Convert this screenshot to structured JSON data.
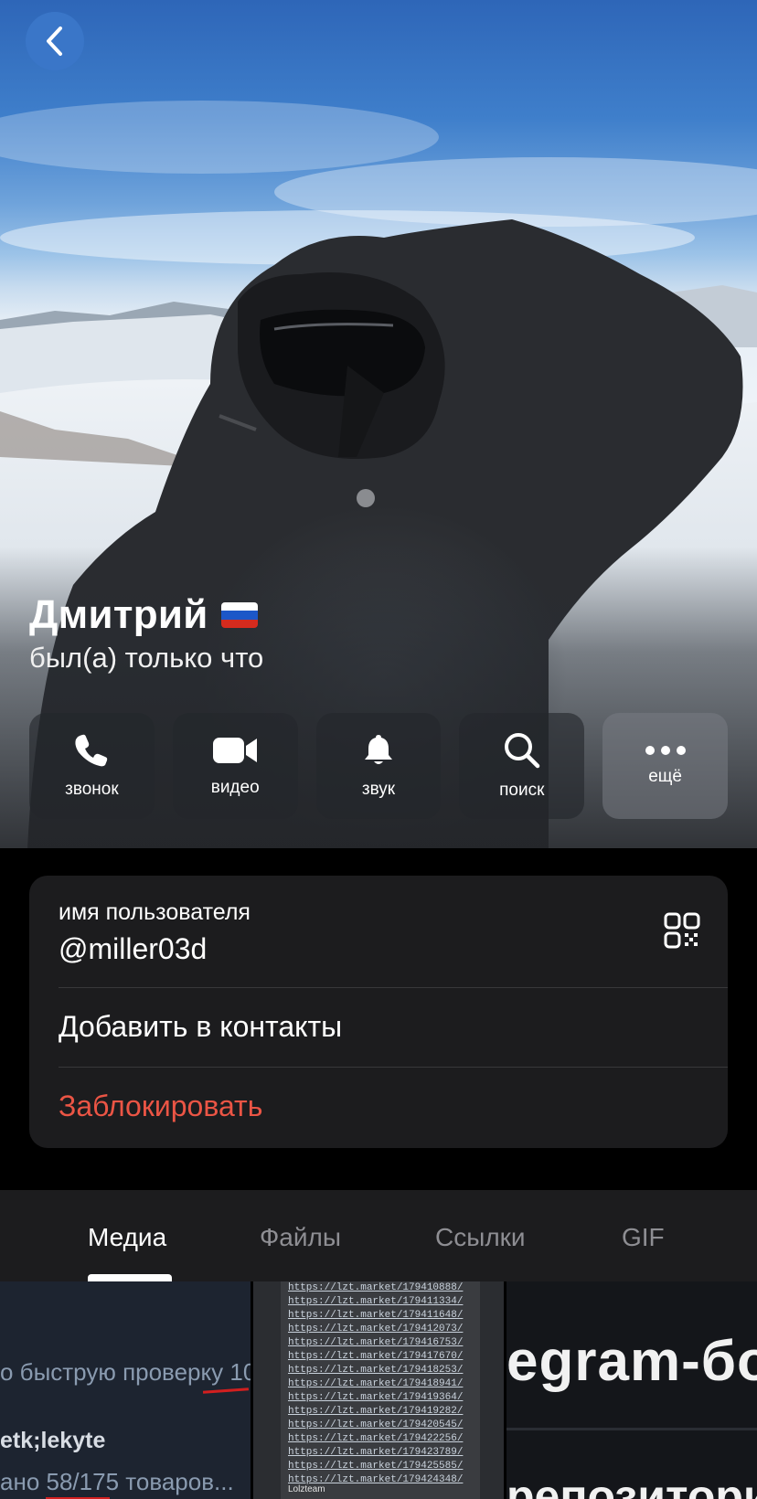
{
  "profile": {
    "name": "Дмитрий",
    "flag": "🇷🇺",
    "status": "был(а) только что"
  },
  "icons": {
    "back": "chevron-left-icon",
    "call": "phone-icon",
    "video": "video-camera-icon",
    "sound": "bell-icon",
    "search": "search-icon",
    "more": "ellipsis-icon",
    "qr": "qr-code-icon"
  },
  "actions": {
    "call": "звонок",
    "video": "видео",
    "sound": "звук",
    "search": "поиск",
    "more": "ещё"
  },
  "info": {
    "username_label": "имя пользователя",
    "username": "@miller03d",
    "add_contact": "Добавить в контакты",
    "block": "Заблокировать"
  },
  "tabs": {
    "media": "Медиа",
    "files": "Файлы",
    "links": "Ссылки",
    "gif": "GIF"
  },
  "media": {
    "thumb1": {
      "line1": "о быструю проверку 10",
      "line2": "etk;lekyte",
      "line3": "ано 58/175 товаров..."
    },
    "thumb2": {
      "links": [
        "https://lzt.market/179410888/",
        "https://lzt.market/179411334/",
        "https://lzt.market/179411648/",
        "https://lzt.market/179412073/",
        "https://lzt.market/179416753/",
        "https://lzt.market/179417670/",
        "https://lzt.market/179418253/",
        "https://lzt.market/179418941/",
        "https://lzt.market/179419364/",
        "https://lzt.market/179419282/",
        "https://lzt.market/179420545/",
        "https://lzt.market/179422256/",
        "https://lzt.market/179423789/",
        "https://lzt.market/179425585/",
        "https://lzt.market/179424348/"
      ],
      "footer": "Lolzteam"
    },
    "thumb3": {
      "line1": "egram-бо",
      "line2": "репозитори"
    }
  },
  "colors": {
    "accent_blue": "#3a76c8",
    "destructive_red": "#eb5545",
    "card_bg": "#1c1c1e"
  }
}
